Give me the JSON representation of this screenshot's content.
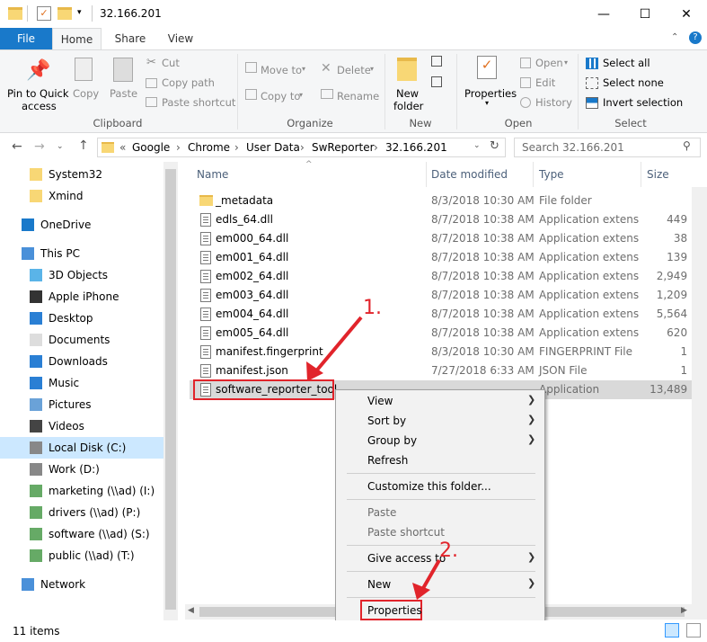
{
  "window": {
    "title": "32.166.201",
    "controls": {
      "minimize": "—",
      "maximize": "☐",
      "close": "✕"
    }
  },
  "ribbon_tabs": [
    "File",
    "Home",
    "Share",
    "View"
  ],
  "ribbon": {
    "clipboard": {
      "pin": "Pin to Quick",
      "pin2": "access",
      "copy": "Copy",
      "paste": "Paste",
      "cut": "Cut",
      "copy_path": "Copy path",
      "paste_shortcut": "Paste shortcut",
      "label": "Clipboard"
    },
    "organize": {
      "move_to": "Move to",
      "copy_to": "Copy to",
      "delete": "Delete",
      "rename": "Rename",
      "label": "Organize"
    },
    "new": {
      "new_folder": "New",
      "new_folder2": "folder",
      "label": "New"
    },
    "open": {
      "properties": "Properties",
      "open": "Open",
      "edit": "Edit",
      "history": "History",
      "label": "Open"
    },
    "select": {
      "select_all": "Select all",
      "select_none": "Select none",
      "invert": "Invert selection",
      "label": "Select"
    }
  },
  "address": {
    "chevrons": "«",
    "crumbs": [
      "Google",
      "Chrome",
      "User Data",
      "SwReporter",
      "32.166.201"
    ],
    "search_placeholder": "Search 32.166.201"
  },
  "nav": [
    {
      "label": "System32",
      "icon": "folder-icon"
    },
    {
      "label": "Xmind",
      "icon": "folder-icon"
    },
    {
      "label": "OneDrive",
      "icon": "cloud-icon"
    },
    {
      "label": "This PC",
      "icon": "computer-icon"
    },
    {
      "label": "3D Objects",
      "icon": "cube-icon"
    },
    {
      "label": "Apple iPhone",
      "icon": "phone-icon"
    },
    {
      "label": "Desktop",
      "icon": "desktop-icon"
    },
    {
      "label": "Documents",
      "icon": "documents-icon"
    },
    {
      "label": "Downloads",
      "icon": "download-icon"
    },
    {
      "label": "Music",
      "icon": "music-icon"
    },
    {
      "label": "Pictures",
      "icon": "pictures-icon"
    },
    {
      "label": "Videos",
      "icon": "videos-icon"
    },
    {
      "label": "Local Disk (C:)",
      "icon": "drive-icon"
    },
    {
      "label": "Work (D:)",
      "icon": "drive-icon"
    },
    {
      "label": "marketing (\\\\ad) (I:)",
      "icon": "network-drive-icon"
    },
    {
      "label": "drivers (\\\\ad) (P:)",
      "icon": "network-drive-icon"
    },
    {
      "label": "software (\\\\ad) (S:)",
      "icon": "network-drive-icon"
    },
    {
      "label": "public (\\\\ad) (T:)",
      "icon": "network-drive-icon"
    },
    {
      "label": "Network",
      "icon": "network-icon"
    }
  ],
  "columns": {
    "name": "Name",
    "date": "Date modified",
    "type": "Type",
    "size": "Size"
  },
  "files": [
    {
      "name": "_metadata",
      "date": "8/3/2018 10:30 AM",
      "type": "File folder",
      "size": ""
    },
    {
      "name": "edls_64.dll",
      "date": "8/7/2018 10:38 AM",
      "type": "Application extens",
      "size": "449 KB"
    },
    {
      "name": "em000_64.dll",
      "date": "8/7/2018 10:38 AM",
      "type": "Application extens",
      "size": "38 KB"
    },
    {
      "name": "em001_64.dll",
      "date": "8/7/2018 10:38 AM",
      "type": "Application extens",
      "size": "139 KB"
    },
    {
      "name": "em002_64.dll",
      "date": "8/7/2018 10:38 AM",
      "type": "Application extens",
      "size": "2,949 KB"
    },
    {
      "name": "em003_64.dll",
      "date": "8/7/2018 10:38 AM",
      "type": "Application extens",
      "size": "1,209 KB"
    },
    {
      "name": "em004_64.dll",
      "date": "8/7/2018 10:38 AM",
      "type": "Application extens",
      "size": "5,564 KB"
    },
    {
      "name": "em005_64.dll",
      "date": "8/7/2018 10:38 AM",
      "type": "Application extens",
      "size": "620 KB"
    },
    {
      "name": "manifest.fingerprint",
      "date": "8/3/2018 10:30 AM",
      "type": "FINGERPRINT File",
      "size": "1 KB"
    },
    {
      "name": "manifest.json",
      "date": "7/27/2018 6:33 AM",
      "type": "JSON File",
      "size": "1 KB"
    },
    {
      "name": "software_reporter_tool",
      "date": "",
      "type": "Application",
      "size": "13,489 KB"
    }
  ],
  "context_menu": {
    "view": "View",
    "sort_by": "Sort by",
    "group_by": "Group by",
    "refresh": "Refresh",
    "customize": "Customize this folder...",
    "paste": "Paste",
    "paste_shortcut": "Paste shortcut",
    "give_access": "Give access to",
    "new": "New",
    "properties": "Properties"
  },
  "annotations": {
    "step1": "1.",
    "step2": "2."
  },
  "status": {
    "items": "11 items"
  },
  "colors": {
    "accent": "#1979ca",
    "annotation": "#e1242b",
    "selected": "#cce8ff"
  }
}
